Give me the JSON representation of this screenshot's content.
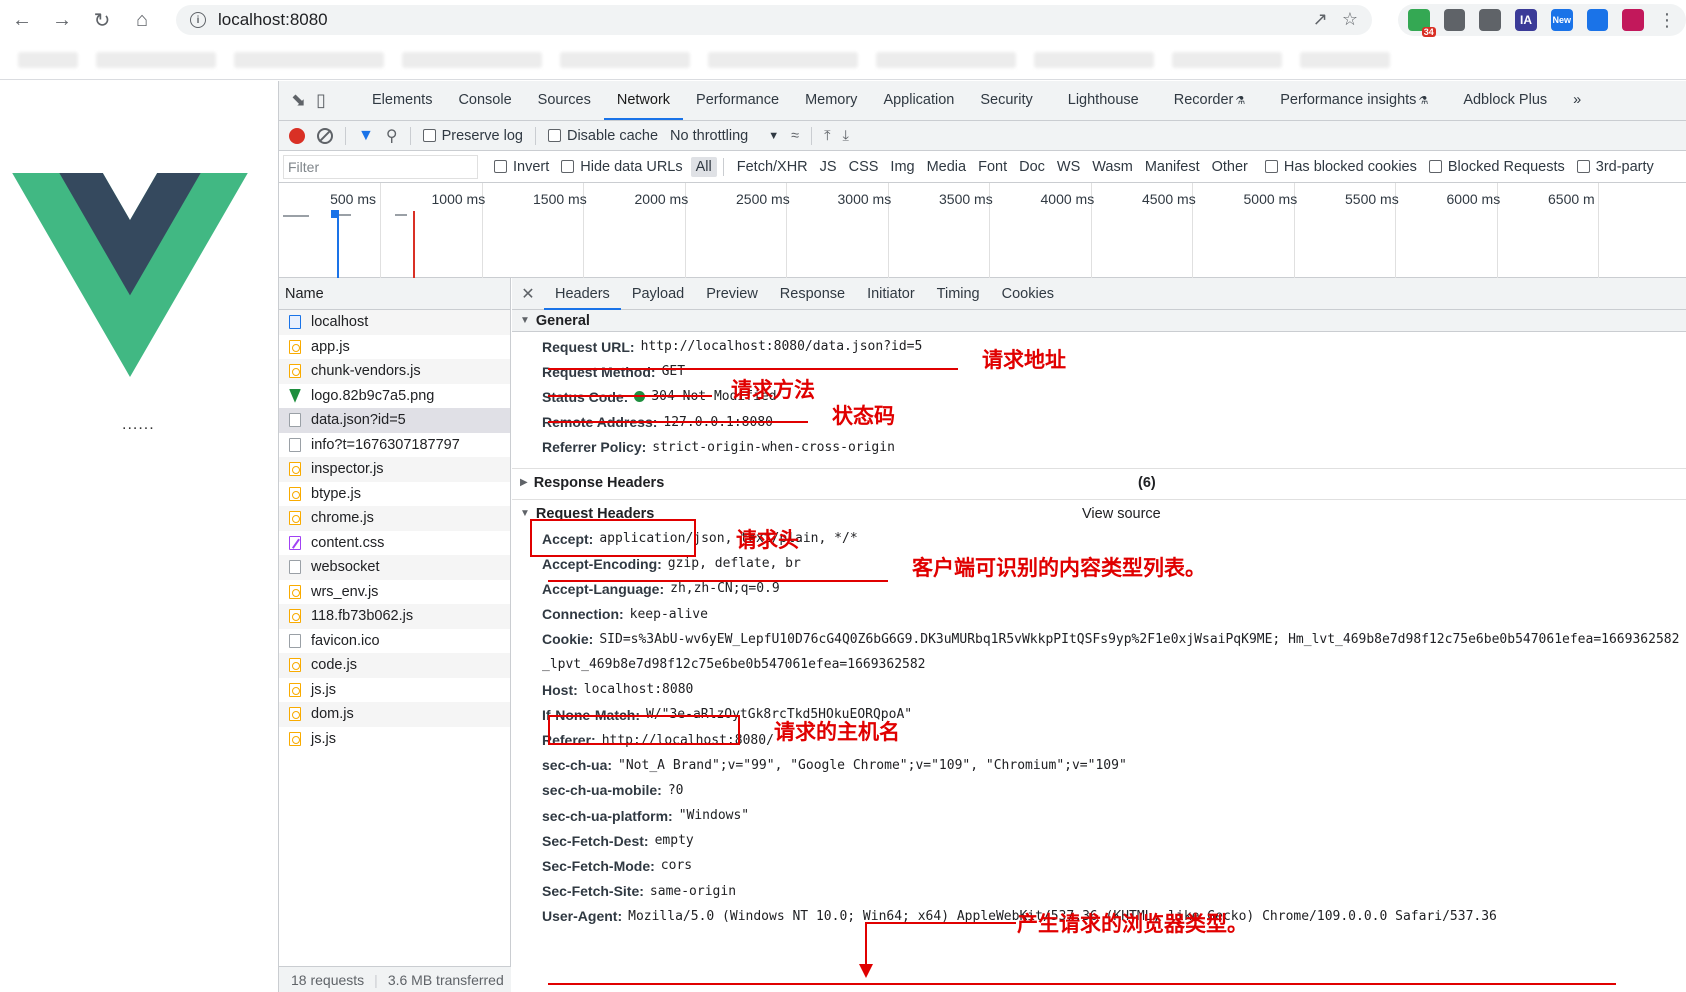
{
  "browser": {
    "url": "localhost:8080",
    "extensions": [
      {
        "name": "extension-puzzle-icon",
        "badge": "34",
        "color": "#34a853"
      },
      {
        "name": "calendar-extension-icon",
        "badge": "",
        "color": "#5f6368"
      },
      {
        "name": "eyedropper-icon",
        "badge": "",
        "color": "#5f6368"
      },
      {
        "name": "ia-extension-icon",
        "label": "IA",
        "color": "#3b3b98"
      },
      {
        "name": "new-extension-icon",
        "label": "New",
        "color": "#1a73e8"
      },
      {
        "name": "download-extension-icon",
        "badge": "",
        "color": "#1a73e8"
      },
      {
        "name": "circle-extension-icon",
        "badge": "",
        "color": "#c2185b"
      }
    ]
  },
  "page": {
    "ellipsis": "......"
  },
  "devtools": {
    "tabs": [
      "Elements",
      "Console",
      "Sources",
      "Network",
      "Performance",
      "Memory",
      "Application",
      "Security",
      "Lighthouse",
      "Recorder",
      "Performance insights",
      "Adblock Plus"
    ],
    "active_tab": "Network",
    "more": "»",
    "toolbar": {
      "preserve_log": "Preserve log",
      "disable_cache": "Disable cache",
      "throttling": "No throttling"
    },
    "filter": {
      "placeholder": "Filter",
      "invert": "Invert",
      "hide_data_urls": "Hide data URLs",
      "types": [
        "All",
        "Fetch/XHR",
        "JS",
        "CSS",
        "Img",
        "Media",
        "Font",
        "Doc",
        "WS",
        "Wasm",
        "Manifest",
        "Other"
      ],
      "has_blocked_cookies": "Has blocked cookies",
      "blocked_requests": "Blocked Requests",
      "third_party": "3rd-party"
    },
    "timeline_ticks": [
      "500 ms",
      "1000 ms",
      "1500 ms",
      "2000 ms",
      "2500 ms",
      "3000 ms",
      "3500 ms",
      "4000 ms",
      "4500 ms",
      "5000 ms",
      "5500 ms",
      "6000 ms",
      "6500 m"
    ],
    "requests": {
      "header": "Name",
      "items": [
        {
          "name": "localhost",
          "type": "doc"
        },
        {
          "name": "app.js",
          "type": "js"
        },
        {
          "name": "chunk-vendors.js",
          "type": "js"
        },
        {
          "name": "logo.82b9c7a5.png",
          "type": "img"
        },
        {
          "name": "data.json?id=5",
          "type": "other",
          "selected": true
        },
        {
          "name": "info?t=1676307187797",
          "type": "other"
        },
        {
          "name": "inspector.js",
          "type": "js"
        },
        {
          "name": "btype.js",
          "type": "js"
        },
        {
          "name": "chrome.js",
          "type": "js"
        },
        {
          "name": "content.css",
          "type": "css"
        },
        {
          "name": "websocket",
          "type": "other"
        },
        {
          "name": "wrs_env.js",
          "type": "js"
        },
        {
          "name": "118.fb73b062.js",
          "type": "js"
        },
        {
          "name": "favicon.ico",
          "type": "other"
        },
        {
          "name": "code.js",
          "type": "js"
        },
        {
          "name": "js.js",
          "type": "js"
        },
        {
          "name": "dom.js",
          "type": "js"
        },
        {
          "name": "js.js",
          "type": "js"
        }
      ],
      "count": "18 requests",
      "transferred": "3.6 MB transferred"
    },
    "details": {
      "tabs": [
        "Headers",
        "Payload",
        "Preview",
        "Response",
        "Initiator",
        "Timing",
        "Cookies"
      ],
      "general_title": "General",
      "general": [
        {
          "k": "Request URL:",
          "v": "http://localhost:8080/data.json?id=5"
        },
        {
          "k": "Request Method:",
          "v": "GET"
        },
        {
          "k": "Status Code:",
          "v": "304 Not Modified"
        },
        {
          "k": "Remote Address:",
          "v": "127.0.0.1:8080"
        },
        {
          "k": "Referrer Policy:",
          "v": "strict-origin-when-cross-origin"
        }
      ],
      "response_headers_title": "Response Headers",
      "response_headers_count": "(6)",
      "request_headers_title": "Request Headers",
      "view_source": "View source",
      "request_headers": [
        {
          "k": "Accept:",
          "v": "application/json, text/plain, */*"
        },
        {
          "k": "Accept-Encoding:",
          "v": "gzip, deflate, br"
        },
        {
          "k": "Accept-Language:",
          "v": "zh,zh-CN;q=0.9"
        },
        {
          "k": "Connection:",
          "v": "keep-alive"
        },
        {
          "k": "Cookie:",
          "v": "SID=s%3AbU-wv6yEW_LepfU10D76cG4Q0Z6bG6G9.DK3uMURbq1R5vWkkpPItQSFs9yp%2F1e0xjWsaiPqK9ME; Hm_lvt_469b8e7d98f12c75e6be0b547061efea=1669362582"
        },
        {
          "k": "",
          "v": "_lpvt_469b8e7d98f12c75e6be0b547061efea=1669362582"
        },
        {
          "k": "Host:",
          "v": "localhost:8080"
        },
        {
          "k": "If-None-Match:",
          "v": "W/\"3e-aRlzOytGk8rcTkd5HOkuEORQpoA\""
        },
        {
          "k": "Referer:",
          "v": "http://localhost:8080/"
        },
        {
          "k": "sec-ch-ua:",
          "v": "\"Not_A Brand\";v=\"99\", \"Google Chrome\";v=\"109\", \"Chromium\";v=\"109\""
        },
        {
          "k": "sec-ch-ua-mobile:",
          "v": "?0"
        },
        {
          "k": "sec-ch-ua-platform:",
          "v": "\"Windows\""
        },
        {
          "k": "Sec-Fetch-Dest:",
          "v": "empty"
        },
        {
          "k": "Sec-Fetch-Mode:",
          "v": "cors"
        },
        {
          "k": "Sec-Fetch-Site:",
          "v": "same-origin"
        },
        {
          "k": "User-Agent:",
          "v": "Mozilla/5.0 (Windows NT 10.0; Win64; x64) AppleWebKit/537.36 (KHTML, like Gecko) Chrome/109.0.0.0 Safari/537.36"
        }
      ]
    }
  },
  "annotations": {
    "request_url": "请求地址",
    "request_method": "请求方法",
    "status_code": "状态码",
    "request_headers": "请求头",
    "accept": "客户端可识别的内容类型列表。",
    "host": "请求的主机名",
    "user_agent": "产生请求的浏览器类型。"
  },
  "colors": {
    "annotation_red": "#e00000",
    "vue_green": "#41b883",
    "vue_dark": "#35495e",
    "accent_blue": "#1a73e8"
  }
}
